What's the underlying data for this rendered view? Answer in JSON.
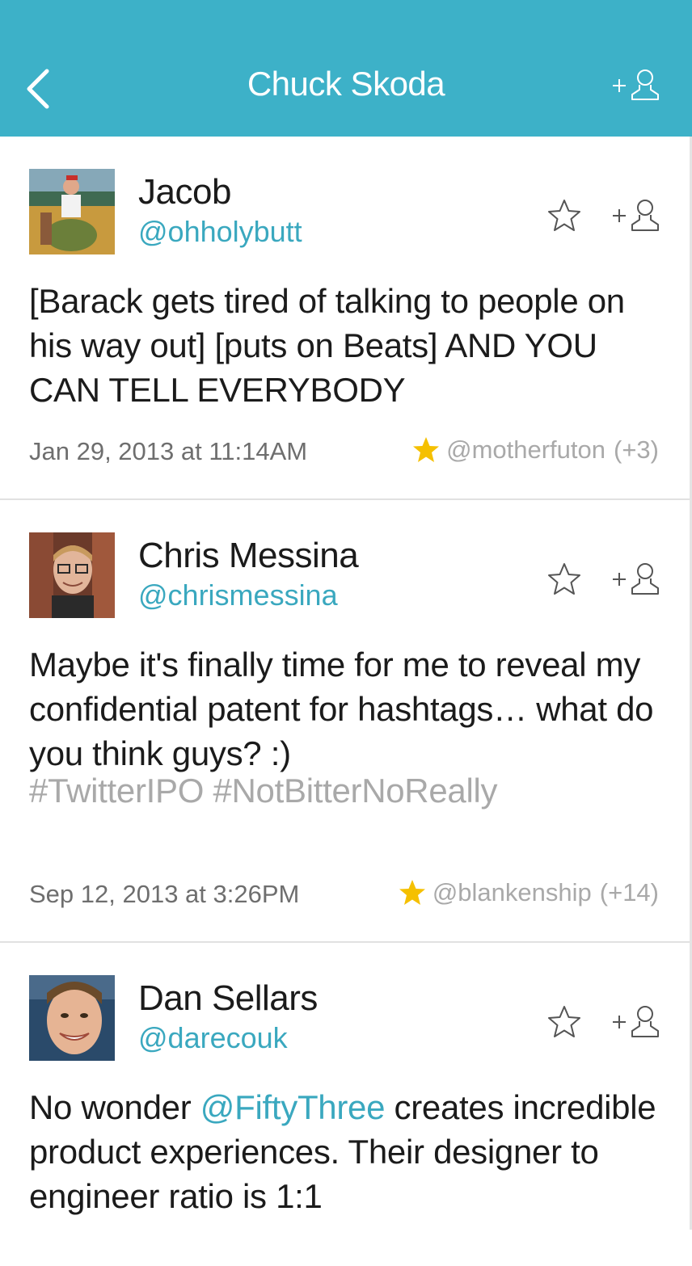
{
  "header": {
    "title": "Chuck Skoda",
    "back_icon": "chevron-left-icon",
    "follow_icon": "add-user-icon",
    "color": "#3db1c8"
  },
  "tweets": [
    {
      "name": "Jacob",
      "handle": "@ohholybutt",
      "text": "[Barack gets tired of talking to people on his way out] [puts on Beats] AND YOU CAN TELL EVERYBODY",
      "time": "Jan 29, 2013 at 11:14AM",
      "fav_user": "@motherfuton",
      "fav_count": "(+3)"
    },
    {
      "name": "Chris Messina",
      "handle": "@chrismessina",
      "text": "Maybe it's finally time for me to reveal my confidential patent for hashtags… what do you think guys? :)",
      "hashtags": [
        "#TwitterIPO",
        "#NotBitterNoReally"
      ],
      "time": "Sep 12, 2013 at 3:26PM",
      "fav_user": "@blankenship",
      "fav_count": "(+14)"
    },
    {
      "name": "Dan Sellars",
      "handle": "@darecouk",
      "text_before": "No wonder ",
      "mention": "@FiftyThree",
      "text_after": " creates incredible product experiences. Their designer to engineer ratio is 1:1"
    }
  ],
  "colors": {
    "accent": "#3db1c8",
    "link": "#3aa8bf",
    "star_gold": "#f5c000",
    "muted": "#a9a9a9"
  }
}
